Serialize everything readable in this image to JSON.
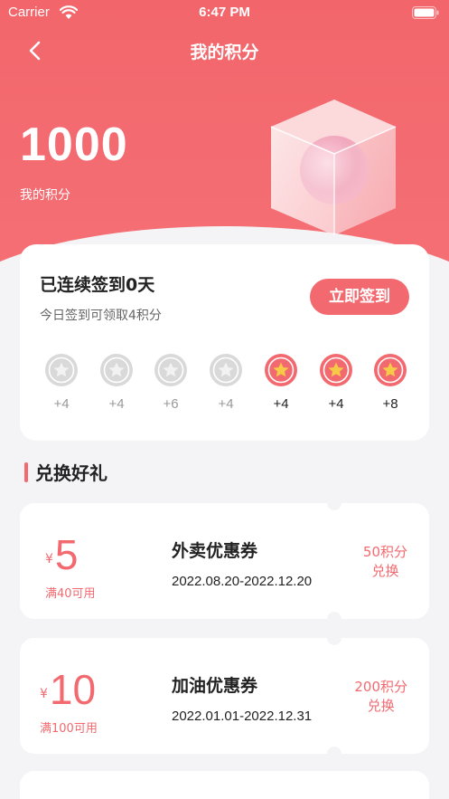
{
  "status_bar": {
    "carrier": "Carrier",
    "time": "6:47 PM"
  },
  "nav": {
    "title": "我的积分"
  },
  "points": {
    "value": "1000",
    "label": "我的积分"
  },
  "signin": {
    "streak_title": "已连续签到0天",
    "subtitle": "今日签到可领取4积分",
    "button_label": "立即签到",
    "days": [
      {
        "reward": "+4",
        "active": false
      },
      {
        "reward": "+4",
        "active": false
      },
      {
        "reward": "+6",
        "active": false
      },
      {
        "reward": "+4",
        "active": false
      },
      {
        "reward": "+4",
        "active": true
      },
      {
        "reward": "+4",
        "active": true
      },
      {
        "reward": "+8",
        "active": true
      }
    ]
  },
  "section": {
    "title": "兑换好礼"
  },
  "coupons": [
    {
      "currency": "¥",
      "amount": "5",
      "condition": "满40可用",
      "name": "外卖优惠券",
      "dates": "2022.08.20-2022.12.20",
      "cost": "50积分",
      "action": "兑换"
    },
    {
      "currency": "¥",
      "amount": "10",
      "condition": "满100可用",
      "name": "加油优惠券",
      "dates": "2022.01.01-2022.12.31",
      "cost": "200积分",
      "action": "兑换"
    }
  ],
  "colors": {
    "brand": "#f26a70",
    "page_bg": "#f4f4f6",
    "star": "#f7c948"
  }
}
